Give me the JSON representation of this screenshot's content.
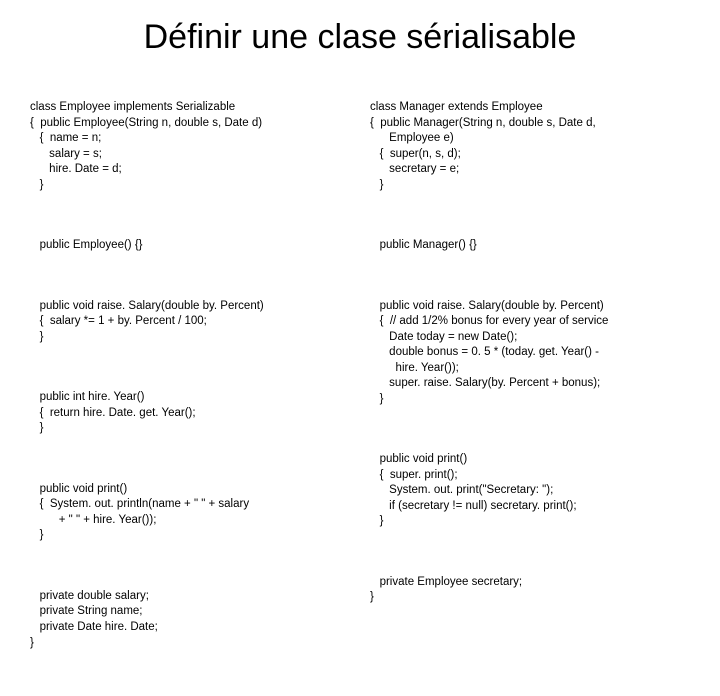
{
  "title": "Définir une clase sérialisable",
  "left": {
    "b1": "class Employee implements Serializable\n{  public Employee(String n, double s, Date d)\n   {  name = n;\n      salary = s;\n      hire. Date = d;\n   }",
    "b2": "   public Employee() {}",
    "b3": "   public void raise. Salary(double by. Percent)\n   {  salary *= 1 + by. Percent / 100;\n   }",
    "b4": "   public int hire. Year()\n   {  return hire. Date. get. Year();\n   }",
    "b5": "   public void print()\n   {  System. out. println(name + \" \" + salary\n         + \" \" + hire. Year());\n   }",
    "b6": "   private double salary;\n   private String name;\n   private Date hire. Date;\n}"
  },
  "right": {
    "b1": "class Manager extends Employee\n{  public Manager(String n, double s, Date d,\n      Employee e)\n   {  super(n, s, d);\n      secretary = e;\n   }",
    "b2": "   public Manager() {}",
    "b3": "   public void raise. Salary(double by. Percent)\n   {  // add 1/2% bonus for every year of service\n      Date today = new Date();\n      double bonus = 0. 5 * (today. get. Year() -\n        hire. Year());\n      super. raise. Salary(by. Percent + bonus);\n   }",
    "b4": "   public void print()\n   {  super. print();\n      System. out. print(\"Secretary: \");\n      if (secretary != null) secretary. print();\n   }",
    "b5": "   private Employee secretary;\n}"
  }
}
